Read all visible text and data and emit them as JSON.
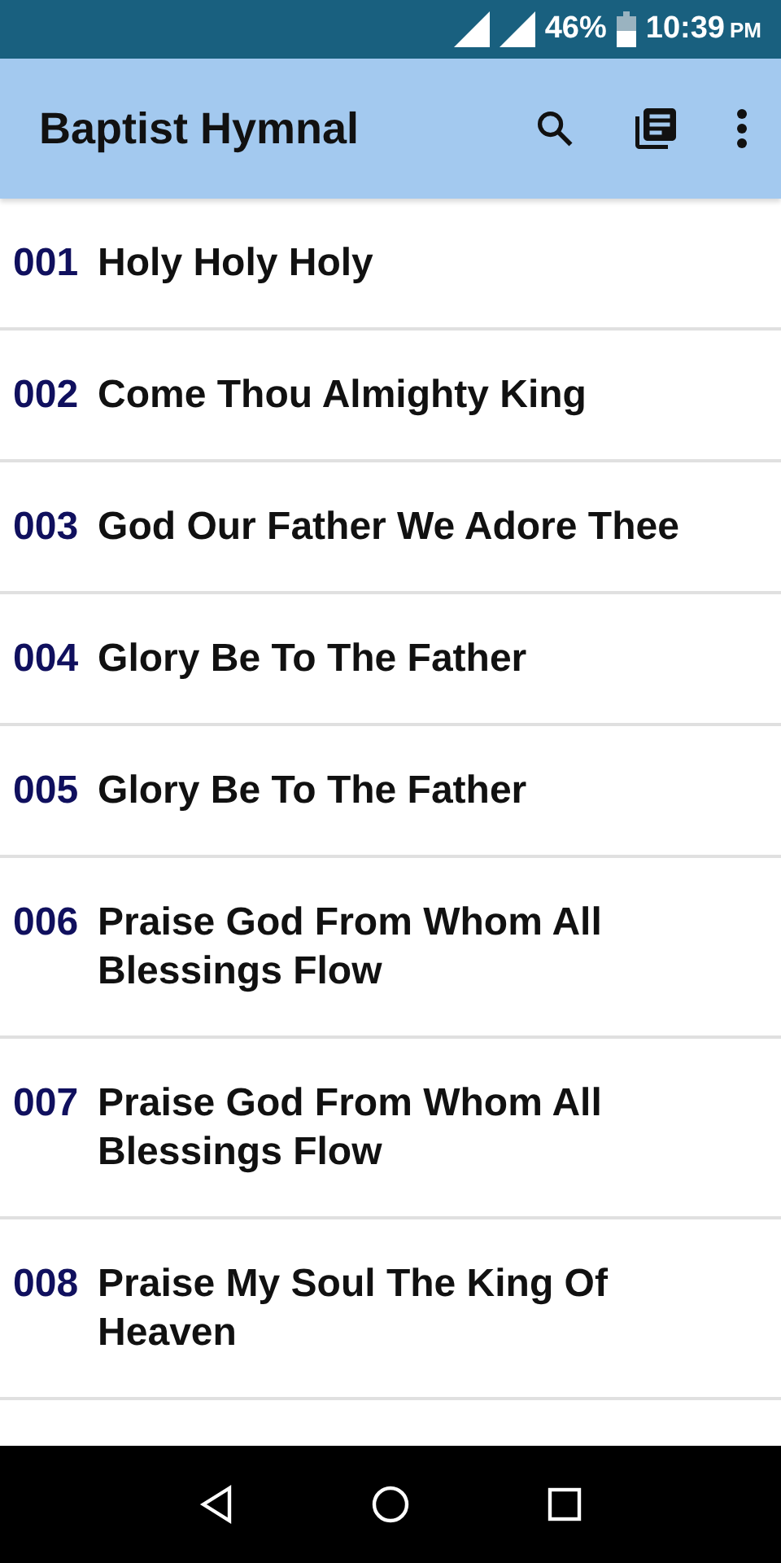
{
  "status_bar": {
    "battery": "46%",
    "time": "10:39",
    "meridiem": "PM"
  },
  "app_bar": {
    "title": "Baptist Hymnal"
  },
  "hymns": [
    {
      "number": "001",
      "title": "Holy Holy Holy"
    },
    {
      "number": "002",
      "title": "Come Thou Almighty King"
    },
    {
      "number": "003",
      "title": "God Our Father We Adore Thee"
    },
    {
      "number": "004",
      "title": "Glory Be To The Father"
    },
    {
      "number": "005",
      "title": "Glory Be To The Father"
    },
    {
      "number": "006",
      "title": "Praise God From Whom All Blessings Flow"
    },
    {
      "number": "007",
      "title": "Praise God From Whom All Blessings Flow"
    },
    {
      "number": "008",
      "title": "Praise My Soul The King Of Heaven"
    }
  ]
}
